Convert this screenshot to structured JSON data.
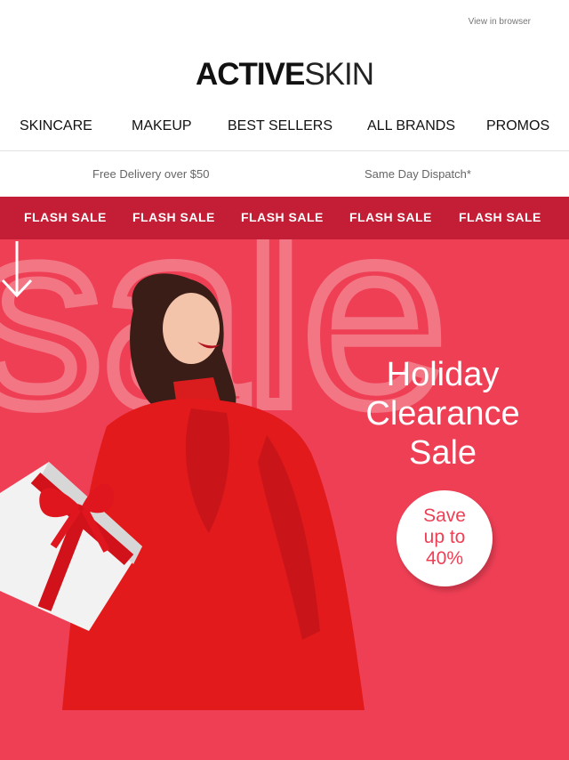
{
  "header": {
    "view_in_browser": "View in browser",
    "logo_bold": "ACTIVE",
    "logo_thin": "SKIN"
  },
  "nav": {
    "items": [
      "SKINCARE",
      "MAKEUP",
      "BEST SELLERS",
      "ALL BRANDS",
      "PROMOS"
    ]
  },
  "usp": {
    "left": "Free Delivery over $50",
    "right": "Same Day Dispatch*"
  },
  "flash_bar": {
    "items": [
      "FLASH SALE",
      "FLASH SALE",
      "FLASH SALE",
      "FLASH SALE",
      "FLASH SALE"
    ],
    "color": "#c41e37"
  },
  "hero": {
    "background_word": "sale",
    "title_lines": [
      "Holiday",
      "Clearance",
      "Sale"
    ],
    "badge_lines": [
      "Save",
      "up to",
      "40%"
    ],
    "accent": "#ef3f55",
    "arrow_icon": "arrow-down-icon"
  }
}
